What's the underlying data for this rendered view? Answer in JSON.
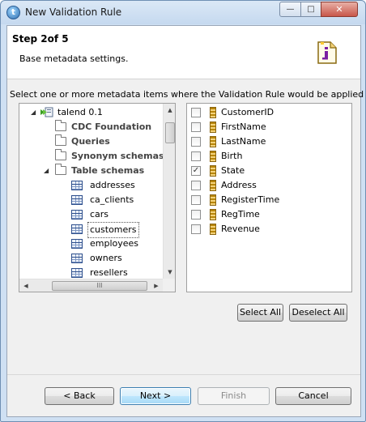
{
  "window": {
    "title": "New Validation Rule",
    "controls": {
      "minimize": "—",
      "maximize": "□",
      "close": "✕"
    }
  },
  "header": {
    "step_title": "Step 2of 5",
    "description": "Base metadata settings."
  },
  "instruction": "Select one or more metadata items where the Validation Rule would be applied",
  "tree": {
    "root": {
      "label": "talend 0.1",
      "expander": "◢"
    },
    "folders": [
      {
        "label": "CDC Foundation"
      },
      {
        "label": "Queries"
      },
      {
        "label": "Synonym schemas"
      },
      {
        "label": "Table schemas",
        "expander": "◢"
      }
    ],
    "tables": [
      {
        "label": "addresses"
      },
      {
        "label": "ca_clients"
      },
      {
        "label": "cars"
      },
      {
        "label": "customers",
        "selected": true
      },
      {
        "label": "employees"
      },
      {
        "label": "owners"
      },
      {
        "label": "resellers"
      }
    ],
    "scroll": {
      "up": "▲",
      "down": "▼",
      "left": "◀",
      "right": "▶",
      "grip": "III"
    }
  },
  "columns": [
    {
      "label": "CustomerID",
      "checked": false
    },
    {
      "label": "FirstName",
      "checked": false
    },
    {
      "label": "LastName",
      "checked": false
    },
    {
      "label": "Birth",
      "checked": false
    },
    {
      "label": "State",
      "checked": true
    },
    {
      "label": "Address",
      "checked": false
    },
    {
      "label": "RegisterTime",
      "checked": false
    },
    {
      "label": "RegTime",
      "checked": false
    },
    {
      "label": "Revenue",
      "checked": false
    }
  ],
  "checkmark": "✓",
  "buttons": {
    "select_all": "Select All",
    "deselect_all": "Deselect All",
    "back": "< Back",
    "next": "Next >",
    "finish": "Finish",
    "cancel": "Cancel"
  }
}
